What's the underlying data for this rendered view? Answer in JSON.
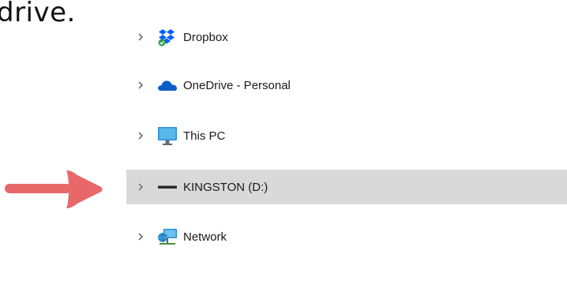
{
  "caption": {
    "text": "drive."
  },
  "tree": {
    "items": [
      {
        "label": "Dropbox",
        "icon": "dropbox-icon",
        "expandable": true,
        "selected": false
      },
      {
        "label": "OneDrive - Personal",
        "icon": "onedrive-cloud-icon",
        "expandable": true,
        "selected": false
      },
      {
        "label": "This PC",
        "icon": "monitor-icon",
        "expandable": true,
        "selected": false
      },
      {
        "label": "KINGSTON (D:)",
        "icon": "usb-drive-icon",
        "expandable": true,
        "selected": true
      },
      {
        "label": "Network",
        "icon": "network-icon",
        "expandable": true,
        "selected": false
      }
    ]
  },
  "annotation": {
    "icon": "pointer-arrow-icon",
    "color": "#e8686a"
  },
  "colors": {
    "selected_row_bg": "#d9d9d9",
    "chevron": "#555555",
    "dropbox_blue": "#0061fe",
    "onedrive_blue": "#0a5fc4",
    "monitor_blue": "#3aa0e0"
  }
}
